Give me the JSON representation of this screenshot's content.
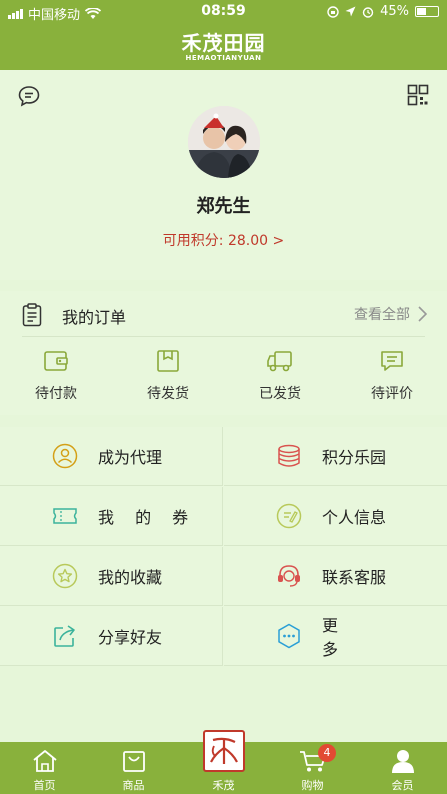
{
  "status_bar": {
    "carrier": "中国移动",
    "time": "08:59",
    "battery": "45%",
    "battery_level": 0.45
  },
  "header": {
    "logo_cn": "禾茂田园",
    "logo_en": "HEMAOTIANYUAN"
  },
  "profile": {
    "name": "郑先生",
    "points_text": "可用积分: 28.00 >"
  },
  "orders": {
    "title": "我的订单",
    "view_all": "查看全部",
    "statuses": [
      {
        "label": "待付款",
        "icon": "wallet-icon"
      },
      {
        "label": "待发货",
        "icon": "package-icon"
      },
      {
        "label": "已发货",
        "icon": "truck-icon"
      },
      {
        "label": "待评价",
        "icon": "comment-icon"
      }
    ]
  },
  "menu": [
    {
      "label": "成为代理",
      "icon": "agent-icon",
      "color": "#d4a017"
    },
    {
      "label": "积分乐园",
      "icon": "coins-icon",
      "color": "#d9534f"
    },
    {
      "label": "我 的 券",
      "icon": "coupon-icon",
      "color": "#3bb39b"
    },
    {
      "label": "个人信息",
      "icon": "profile-edit-icon",
      "color": "#b8c95a"
    },
    {
      "label": "我的收藏",
      "icon": "star-icon",
      "color": "#b8c95a"
    },
    {
      "label": "联系客服",
      "icon": "headset-icon",
      "color": "#d9534f"
    },
    {
      "label": "分享好友",
      "icon": "share-icon",
      "color": "#3bb39b"
    },
    {
      "label": "更 多",
      "icon": "more-icon",
      "color": "#2a9fd6"
    }
  ],
  "tabbar": {
    "items": [
      {
        "label": "首页",
        "icon": "home-icon"
      },
      {
        "label": "商品",
        "icon": "bag-icon"
      },
      {
        "label": "禾茂",
        "icon": "seal-logo-icon"
      },
      {
        "label": "购物",
        "icon": "cart-icon",
        "badge": "4"
      },
      {
        "label": "会员",
        "icon": "member-icon"
      }
    ]
  },
  "colors": {
    "brand_green": "#89b13c",
    "background": "#e8f7dc",
    "points_red": "#c0392b"
  }
}
